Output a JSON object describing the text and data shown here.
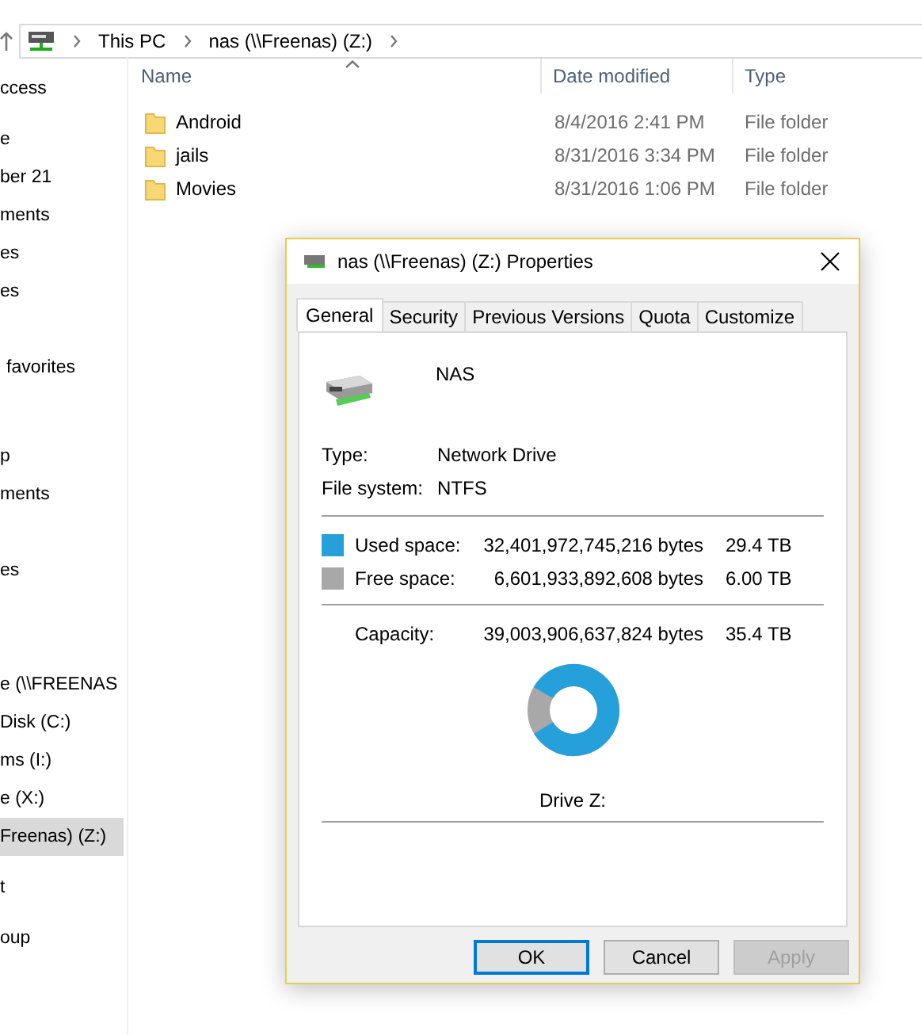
{
  "address_bar": {
    "crumbs": [
      "This PC",
      "nas (\\\\Freenas) (Z:)"
    ]
  },
  "sidebar": {
    "sections": [
      {
        "items": [
          {
            "label": "ccess",
            "selected": false
          }
        ]
      },
      {
        "items": [
          {
            "label": "e",
            "selected": false
          },
          {
            "label": "ber 21",
            "selected": false
          },
          {
            "label": "ments",
            "selected": false
          },
          {
            "label": "es",
            "selected": false
          },
          {
            "label": "es",
            "selected": false
          }
        ]
      },
      {
        "items": [
          {
            "label": "favorites",
            "selected": false
          }
        ]
      },
      {
        "items": [
          {
            "label": "p",
            "selected": false
          },
          {
            "label": "ments",
            "selected": false
          }
        ]
      },
      {
        "items": [
          {
            "label": "es",
            "selected": false
          }
        ]
      },
      {
        "items": [
          {
            "label": "e (\\\\FREENAS",
            "selected": false
          },
          {
            "label": "Disk (C:)",
            "selected": false
          },
          {
            "label": "ms (I:)",
            "selected": false
          },
          {
            "label": "e (X:)",
            "selected": false
          },
          {
            "label": "Freenas) (Z:)",
            "selected": true
          }
        ]
      },
      {
        "items": [
          {
            "label": "t",
            "selected": false
          }
        ]
      },
      {
        "items": [
          {
            "label": "oup",
            "selected": false
          }
        ]
      }
    ]
  },
  "file_list": {
    "columns": [
      "Name",
      "Date modified",
      "Type"
    ],
    "rows": [
      {
        "name": "Android",
        "date": "8/4/2016 2:41 PM",
        "type": "File folder"
      },
      {
        "name": "jails",
        "date": "8/31/2016 3:34 PM",
        "type": "File folder"
      },
      {
        "name": "Movies",
        "date": "8/31/2016 1:06 PM",
        "type": "File folder"
      }
    ]
  },
  "dialog": {
    "title": "nas (\\\\Freenas) (Z:) Properties",
    "tabs": [
      {
        "label": "General",
        "selected": true
      },
      {
        "label": "Security",
        "selected": false
      },
      {
        "label": "Previous Versions",
        "selected": false
      },
      {
        "label": "Quota",
        "selected": false
      },
      {
        "label": "Customize",
        "selected": false
      }
    ],
    "drive_name": "NAS",
    "info": [
      {
        "label": "Type:",
        "value": "Network Drive"
      },
      {
        "label": "File system:",
        "value": "NTFS"
      }
    ],
    "space": [
      {
        "label": "Used space:",
        "bytes": "32,401,972,745,216 bytes",
        "size": "29.4 TB",
        "color": "#26a0da"
      },
      {
        "label": "Free space:",
        "bytes": "6,601,933,892,608 bytes",
        "size": "6.00 TB",
        "color": "#a8a8a8"
      }
    ],
    "capacity": {
      "label": "Capacity:",
      "bytes": "39,003,906,637,824 bytes",
      "size": "35.4 TB"
    },
    "usage_chart": {
      "level": 0.83
    },
    "drive_label": "Drive Z:",
    "buttons": [
      {
        "label": "OK",
        "default": true,
        "disabled": false
      },
      {
        "label": "Cancel",
        "default": false,
        "disabled": false
      },
      {
        "label": "Apply",
        "default": false,
        "disabled": true
      }
    ]
  }
}
